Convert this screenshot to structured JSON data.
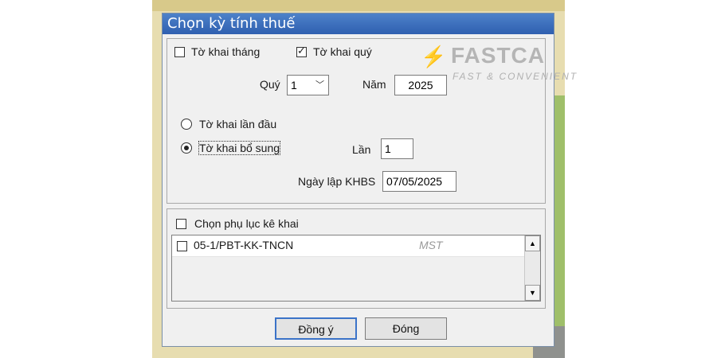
{
  "dialog": {
    "title": "Chọn kỳ tính thuế"
  },
  "declaration_type": {
    "monthly_label": "Tờ khai tháng",
    "monthly_checked": false,
    "quarterly_label": "Tờ khai quý",
    "quarterly_checked": true
  },
  "period": {
    "quarter_label": "Quý",
    "quarter_value": "1",
    "year_label": "Năm",
    "year_value": "2025"
  },
  "submission": {
    "first_label": "Tờ khai lần đầu",
    "supplement_label": "Tờ khai bổ sung",
    "selected": "supplement",
    "times_label": "Lần",
    "times_value": "1",
    "date_label": "Ngày lập KHBS",
    "date_value": "07/05/2025"
  },
  "appendix": {
    "select_label": "Chọn phụ lục kê khai",
    "items": [
      {
        "label": "05-1/PBT-KK-TNCN",
        "checked": false
      }
    ],
    "mst_placeholder": "MST"
  },
  "buttons": {
    "ok": "Đồng ý",
    "close": "Đóng"
  },
  "watermark": {
    "brand": "FASTCA",
    "tagline": "FAST & CONVENIENT"
  },
  "colors": {
    "titlebar": "#2f5fb0",
    "default_button_border": "#3b73c8",
    "window_bg": "#f0f0f0"
  }
}
